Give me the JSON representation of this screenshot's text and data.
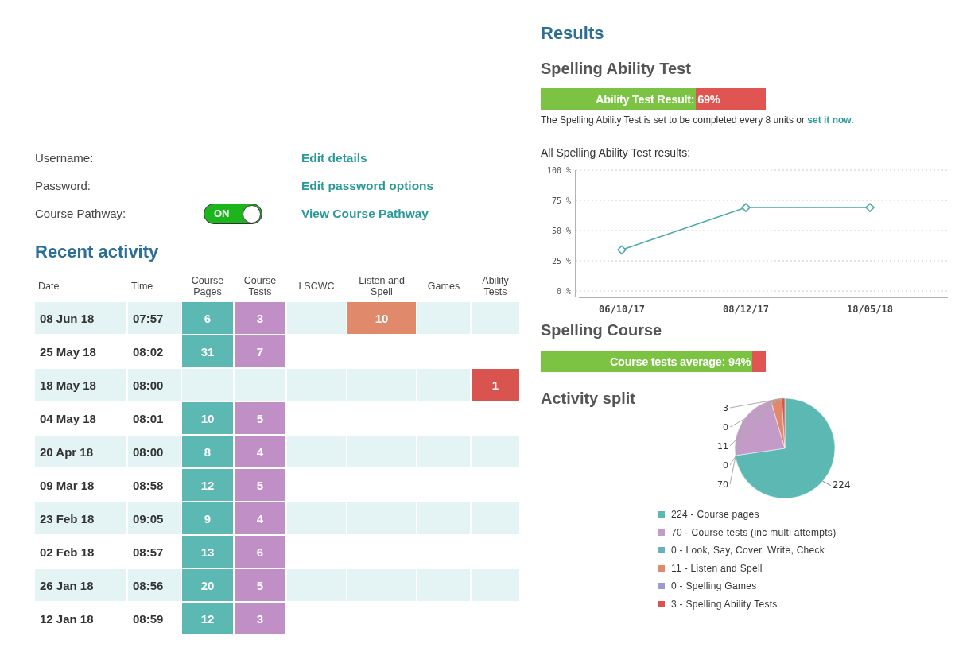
{
  "account": {
    "rows": [
      {
        "label": "Username:",
        "link": "Edit details"
      },
      {
        "label": "Password:",
        "link": "Edit password options"
      },
      {
        "label": "Course Pathway:",
        "toggle": {
          "text": "ON",
          "on": true
        },
        "link": "View Course Pathway"
      }
    ]
  },
  "recent_activity": {
    "title": "Recent activity",
    "columns": [
      {
        "label": "Date"
      },
      {
        "label": "Time"
      },
      {
        "label": "Course Pages",
        "color": "#5cb8b2"
      },
      {
        "label": "Course Tests",
        "color": "#c08fc6"
      },
      {
        "label": "LSCWC"
      },
      {
        "label": "Listen and Spell",
        "color": "#e0896b"
      },
      {
        "label": "Games"
      },
      {
        "label": "Ability Tests",
        "color": "#d9534f"
      }
    ],
    "rows": [
      {
        "date": "08 Jun 18",
        "time": "07:57",
        "course_pages": "6",
        "course_tests": "3",
        "listen_and_spell": "10"
      },
      {
        "date": "25 May 18",
        "time": "08:02",
        "course_pages": "31",
        "course_tests": "7"
      },
      {
        "date": "18 May 18",
        "time": "08:00",
        "ability_tests": "1"
      },
      {
        "date": "04 May 18",
        "time": "08:01",
        "course_pages": "10",
        "course_tests": "5"
      },
      {
        "date": "20 Apr 18",
        "time": "08:00",
        "course_pages": "8",
        "course_tests": "4"
      },
      {
        "date": "09 Mar 18",
        "time": "08:58",
        "course_pages": "12",
        "course_tests": "5"
      },
      {
        "date": "23 Feb 18",
        "time": "09:05",
        "course_pages": "9",
        "course_tests": "4"
      },
      {
        "date": "02 Feb 18",
        "time": "08:57",
        "course_pages": "13",
        "course_tests": "6"
      },
      {
        "date": "26 Jan 18",
        "time": "08:56",
        "course_pages": "20",
        "course_tests": "5"
      },
      {
        "date": "12 Jan 18",
        "time": "08:59",
        "course_pages": "12",
        "course_tests": "3"
      }
    ]
  },
  "results": {
    "title": "Results",
    "ability_test": {
      "title": "Spelling Ability Test",
      "bar": {
        "label": "Ability Test Result:",
        "value": "69%",
        "level": 0.69
      },
      "note": {
        "text": "The Spelling Ability Test is set to be completed every 8 units or ",
        "link": "set it now."
      },
      "chart_title": "All Spelling Ability Test results:",
      "chart_data": {
        "type": "line",
        "categories": [
          "06/10/17",
          "08/12/17",
          "18/05/18"
        ],
        "series": [
          {
            "color": "#4aa9a9",
            "marker": "diamond",
            "values": [
              34,
              69,
              69
            ]
          }
        ],
        "ylim": [
          0,
          100
        ],
        "grid": true,
        "yticks": [
          {
            "value": 0,
            "label": "0 %"
          },
          {
            "value": 25,
            "label": "25 %"
          },
          {
            "value": 50,
            "label": "50 %"
          },
          {
            "value": 75,
            "label": "75 %"
          },
          {
            "value": 100,
            "label": "100 %"
          }
        ]
      }
    },
    "course": {
      "title": "Spelling Course",
      "bar": {
        "label": "Course tests average: 94%",
        "level": 0.94
      }
    },
    "activity_split": {
      "title": "Activity split",
      "chart_data": {
        "type": "pie",
        "values": [
          224,
          70,
          0,
          11,
          0,
          3
        ],
        "value_labels": [
          "224",
          "70",
          "0",
          "11",
          "0",
          "3"
        ]
      },
      "legend": [
        {
          "text": "224 - Course pages",
          "color": "#5cb8b2"
        },
        {
          "text": "70 - Course tests (inc multi attempts)",
          "color": "#c49ac9"
        },
        {
          "text": "0 - Look, Say, Cover, Write, Check",
          "color": "#6aaec4"
        },
        {
          "text": "11 - Listen and Spell",
          "color": "#e0896b"
        },
        {
          "text": "0 - Spelling Games",
          "color": "#9b9bcf"
        },
        {
          "text": "3 - Spelling Ability Tests",
          "color": "#d9534f"
        }
      ]
    }
  }
}
